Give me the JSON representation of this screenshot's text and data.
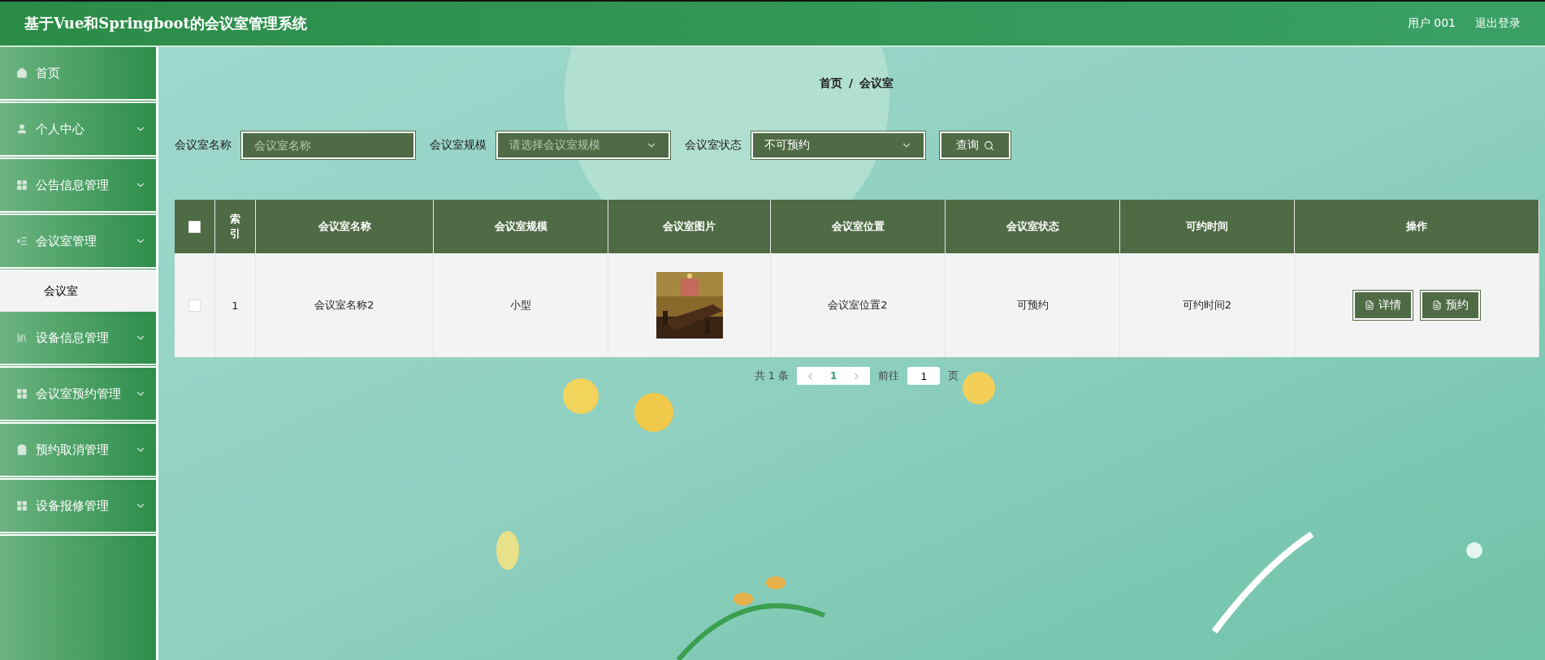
{
  "header": {
    "title": "基于Vue和Springboot的会议室管理系统",
    "user": "用户 001",
    "logout": "退出登录"
  },
  "sidebar": {
    "items": [
      {
        "label": "首页",
        "has_arrow": false
      },
      {
        "label": "个人中心",
        "has_arrow": true,
        "expanded": false
      },
      {
        "label": "公告信息管理",
        "has_arrow": true,
        "expanded": false
      },
      {
        "label": "会议室管理",
        "has_arrow": true,
        "expanded": true,
        "children": [
          {
            "label": "会议室",
            "selected": true
          }
        ]
      },
      {
        "label": "设备信息管理",
        "has_arrow": true,
        "expanded": false
      },
      {
        "label": "会议室预约管理",
        "has_arrow": true,
        "expanded": false
      },
      {
        "label": "预约取消管理",
        "has_arrow": true,
        "expanded": false
      },
      {
        "label": "设备报修管理",
        "has_arrow": true,
        "expanded": false
      }
    ]
  },
  "breadcrumb": [
    "首页",
    "/",
    "会议室"
  ],
  "search": {
    "fields": [
      {
        "kind": "input",
        "label": "会议室名称",
        "placeholder": "会议室名称"
      },
      {
        "kind": "select",
        "label": "会议室规模",
        "placeholder": "请选择会议室规模"
      },
      {
        "kind": "select",
        "label": "会议室状态",
        "value": "不可预约"
      }
    ],
    "button": "查询"
  },
  "table": {
    "select_all": {
      "checked": false
    },
    "columns": [
      "索引",
      "会议室名称",
      "会议室规模",
      "会议室图片",
      "会议室位置",
      "会议室状态",
      "可约时间",
      "操作"
    ],
    "rows": [
      {
        "checked": false,
        "cells": [
          "1",
          "会议室名称2",
          "小型",
          null,
          "会议室位置2",
          "可预约",
          "可约时间2"
        ],
        "picture": {
          "kind": "picture"
        },
        "actions": [
          "详情",
          "预约"
        ]
      }
    ]
  },
  "pagination": {
    "total": "共 1 条",
    "pages": [
      {
        "label": "1",
        "selected": true
      }
    ],
    "goto": "前往",
    "goto_value": "1",
    "page_unit": "页"
  }
}
